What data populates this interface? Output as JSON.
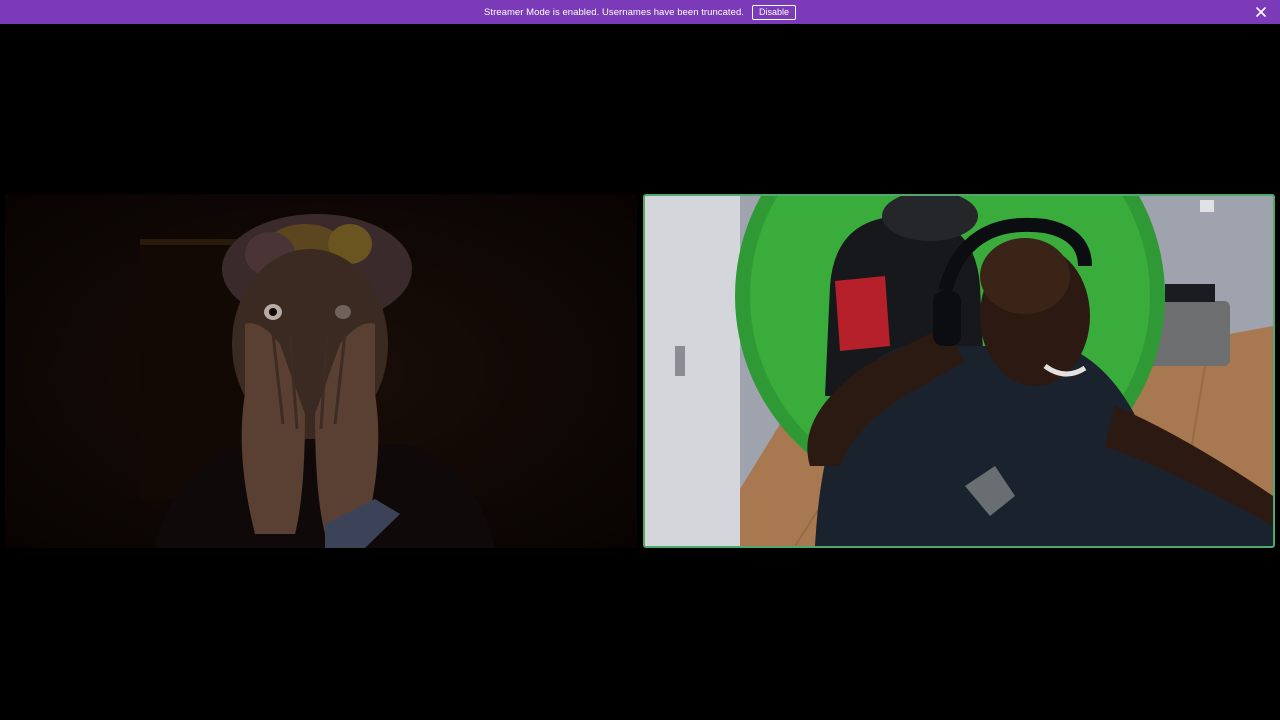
{
  "banner": {
    "message": "Streamer Mode is enabled. Usernames have been truncated.",
    "disable_label": "Disable",
    "background_color": "#7b3ab7",
    "close_icon": "close-icon"
  },
  "video_grid": {
    "participants": [
      {
        "position": "left",
        "speaking": false
      },
      {
        "position": "right",
        "speaking": true,
        "speaking_border_color": "#4fa86d"
      }
    ]
  }
}
